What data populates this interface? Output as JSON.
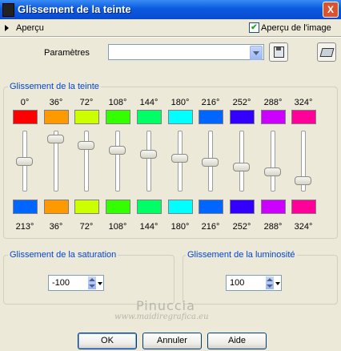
{
  "window": {
    "title": "Glissement de la teinte",
    "close": "X"
  },
  "apercu": {
    "label": "Aperçu",
    "checkbox_label": "Aperçu de l'image",
    "checked": true
  },
  "parametres": {
    "label": "Paramètres",
    "value": ""
  },
  "hue_group": {
    "title": "Glissement de la teinte",
    "channels": [
      {
        "top_label": "0°",
        "top_color": "#ff0000",
        "bottom_color": "#0066ff",
        "bottom_label": "213°",
        "slider": 0.5
      },
      {
        "top_label": "36°",
        "top_color": "#ff9900",
        "bottom_color": "#ff9900",
        "bottom_label": "36°",
        "slider": 0.07
      },
      {
        "top_label": "72°",
        "top_color": "#ccff00",
        "bottom_color": "#ccff00",
        "bottom_label": "72°",
        "slider": 0.2
      },
      {
        "top_label": "108°",
        "top_color": "#33ff00",
        "bottom_color": "#33ff00",
        "bottom_label": "108°",
        "slider": 0.29
      },
      {
        "top_label": "144°",
        "top_color": "#00ff66",
        "bottom_color": "#00ff66",
        "bottom_label": "144°",
        "slider": 0.36
      },
      {
        "top_label": "180°",
        "top_color": "#00ffff",
        "bottom_color": "#00ffff",
        "bottom_label": "180°",
        "slider": 0.44
      },
      {
        "top_label": "216°",
        "top_color": "#0066ff",
        "bottom_color": "#0066ff",
        "bottom_label": "216°",
        "slider": 0.51
      },
      {
        "top_label": "252°",
        "top_color": "#3300ff",
        "bottom_color": "#3300ff",
        "bottom_label": "252°",
        "slider": 0.61
      },
      {
        "top_label": "288°",
        "top_color": "#cc00ff",
        "bottom_color": "#cc00ff",
        "bottom_label": "288°",
        "slider": 0.7
      },
      {
        "top_label": "324°",
        "top_color": "#ff0099",
        "bottom_color": "#ff0099",
        "bottom_label": "324°",
        "slider": 0.86
      }
    ]
  },
  "saturation": {
    "title": "Glissement de la saturation",
    "value": "-100"
  },
  "luminosite": {
    "title": "Glissement de la luminosité",
    "value": "100"
  },
  "watermark": {
    "name": "Pinuccia",
    "url": "www.maidiregrafica.eu"
  },
  "buttons": {
    "ok": "OK",
    "annuler": "Annuler",
    "aide": "Aide"
  }
}
